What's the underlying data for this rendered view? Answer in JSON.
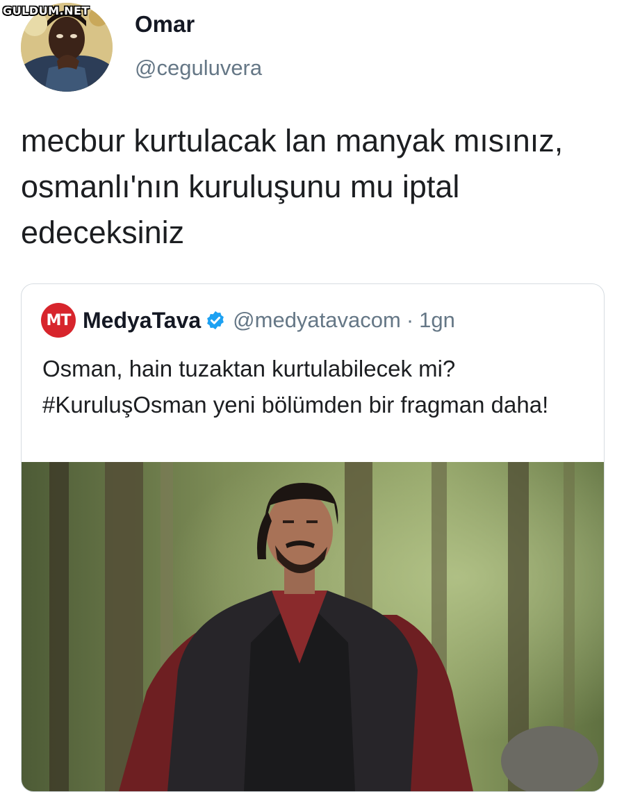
{
  "watermark": "GULDUM.NET",
  "tweet": {
    "author_name": "Omar",
    "author_handle": "@ceguluvera",
    "text": "mecbur kurtulacak lan manyak mısınız, osmanlı'nın kuruluşunu mu iptal edeceksiniz"
  },
  "quoted_tweet": {
    "logo_text": "MT",
    "author_name": "MedyaTava",
    "verified": true,
    "author_handle": "@medyatavacom",
    "separator": "·",
    "time": "1gn",
    "text": "Osman, hain tuzaktan kurtulabilecek mi? #KuruluşOsman yeni bölümden bir fragman daha!"
  },
  "colors": {
    "text_primary": "#141823",
    "text_secondary": "#657786",
    "verified_blue": "#1da1f2",
    "logo_red": "#d7252c",
    "card_border": "#d6dce1"
  },
  "icons": [
    "verified-badge-icon",
    "medyatava-logo-icon"
  ]
}
